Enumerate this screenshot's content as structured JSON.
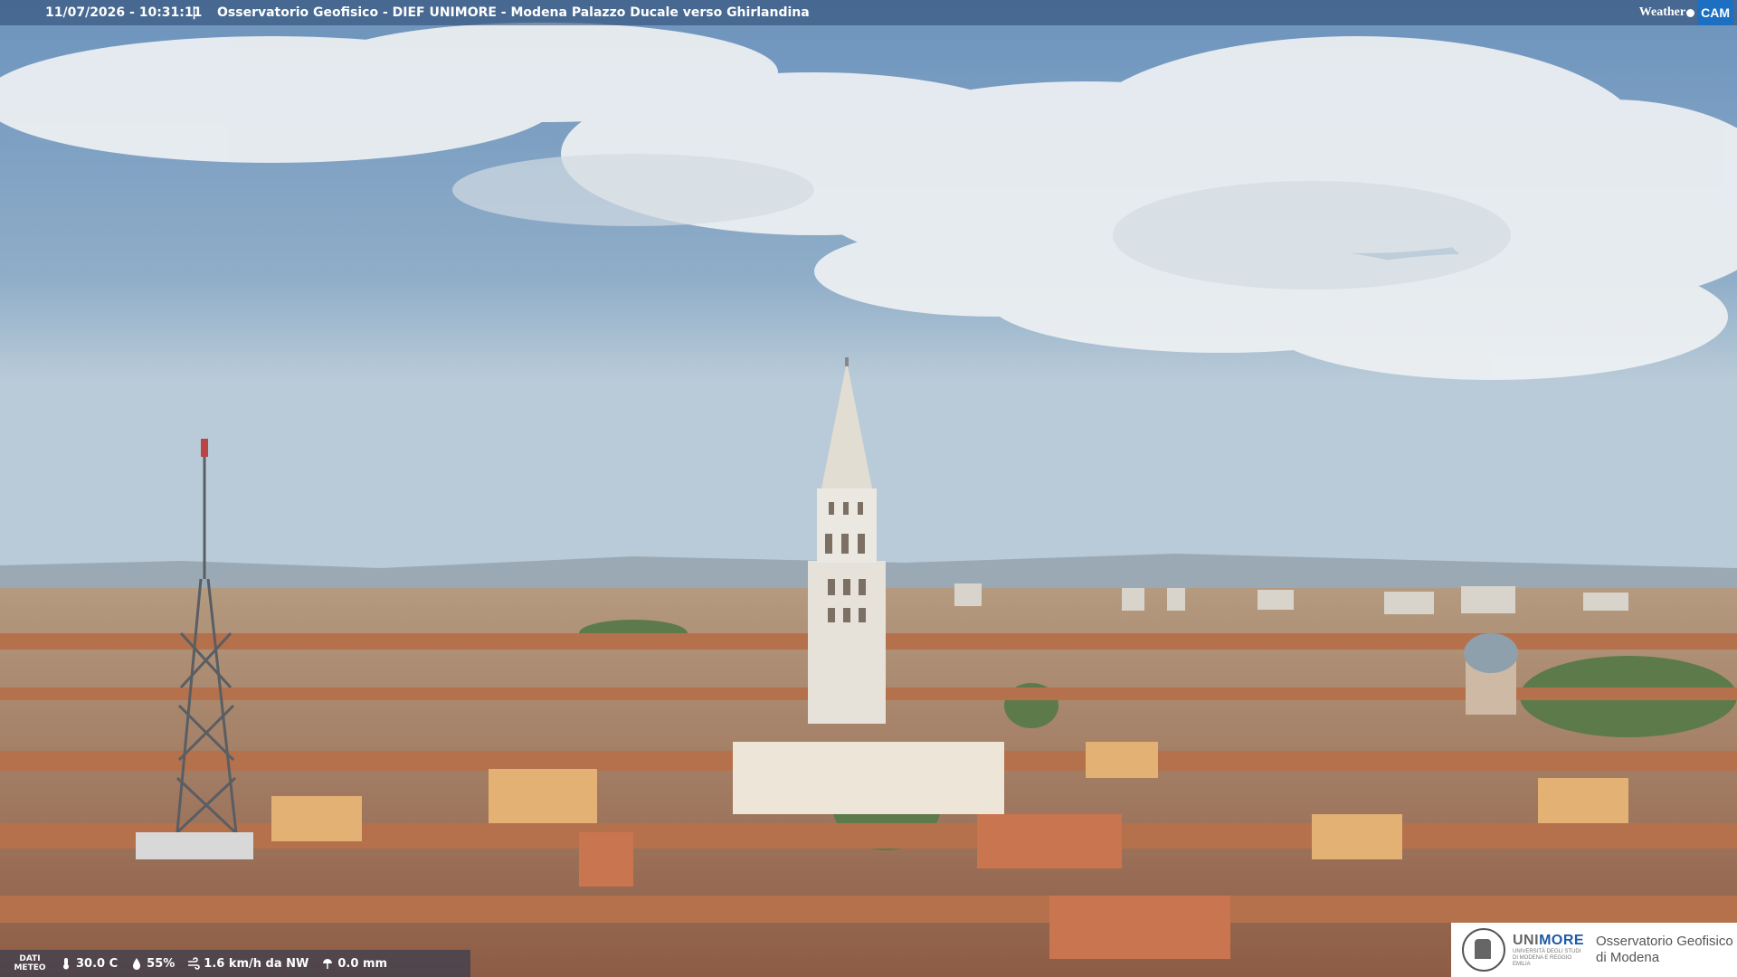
{
  "overlay": {
    "timestamp": "11/07/2026 - 10:31:11",
    "separator": "|",
    "title": "Osservatorio Geofisico - DIEF UNIMORE - Modena Palazzo Ducale verso Ghirlandina",
    "brand_weather": "Weather",
    "brand_cam": "CAM"
  },
  "meteo": {
    "label": "DATI METEO",
    "temperature": "30.0 C",
    "humidity": "55%",
    "wind": "1.6 km/h da NW",
    "rain": "0.0 mm"
  },
  "footer_logo": {
    "brand_prefix": "UNI",
    "brand_suffix": "MORE",
    "brand_sub": "UNIVERSITÀ DEGLI STUDI DI MODENA E REGGIO EMILIA",
    "observatory_line1": "Osservatorio Geofisico",
    "observatory_line2": "di Modena"
  },
  "colors": {
    "sky_top": "#6f95bd",
    "sky_horizon": "#c4d3de",
    "roof": "#a86a4c",
    "wall": "#d9a56a",
    "tower": "#e8e4dc"
  }
}
